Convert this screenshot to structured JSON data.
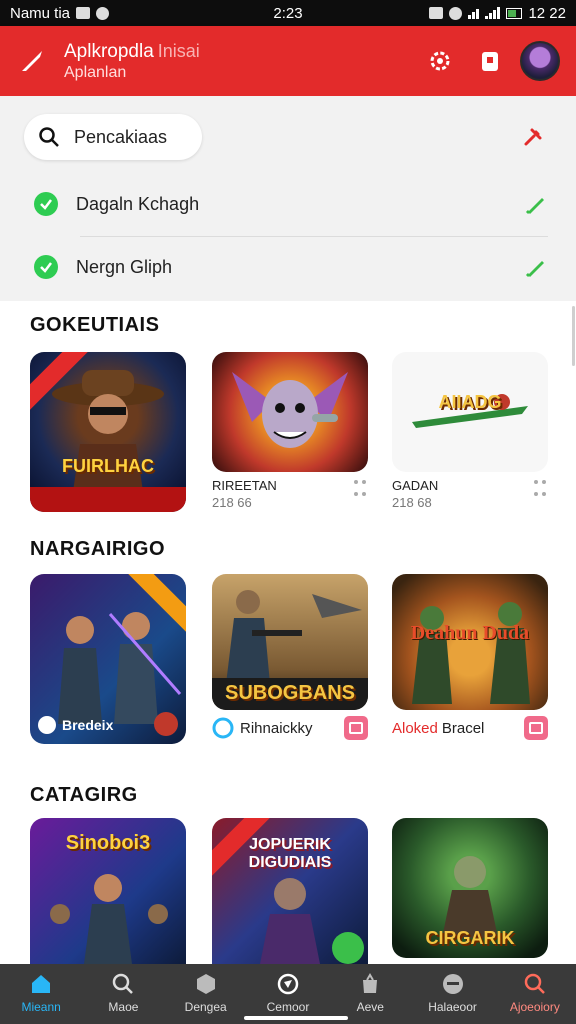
{
  "status_bar": {
    "carrier": "Namu tia",
    "time": "2:23",
    "clock_right": "12 22"
  },
  "header": {
    "title": "Aplkropdla",
    "title_accent": "Inisai",
    "subtitle": "Aplanlan",
    "color": "#e32b2b",
    "icons": [
      "brush-icon",
      "settings-icon",
      "clipboard-icon",
      "avatar"
    ]
  },
  "search": {
    "query": "Pencakiaas"
  },
  "filters": [
    {
      "label": "Dagaln Kchagh"
    },
    {
      "label": "Nergn Gliph"
    }
  ],
  "sections": [
    {
      "title": "GOKEUTIAIS",
      "cards": [
        {
          "name": "",
          "size": "",
          "art_text": "FUIRLHAC",
          "ribbon": ""
        },
        {
          "name": "RIREETAN",
          "size": "218 66"
        },
        {
          "name": "GADAN",
          "size": "218 68",
          "art_text": "AIIADG"
        }
      ]
    },
    {
      "title": "NARGAIRIGO",
      "cards": [
        {
          "name": "Bredeix"
        },
        {
          "name": "Rihnaickky",
          "art_text": "SUBOGBANS"
        },
        {
          "name": "Bracel",
          "name_prefix": "Aloked",
          "art_text": "Deahun Duda"
        }
      ]
    },
    {
      "title": "CATAGIRG",
      "cards": [
        {
          "art_text": "Sinoboi3"
        },
        {
          "art_text": "JOPUERIK DIGUDIAIS"
        },
        {
          "art_text": "CIRGARIK"
        }
      ]
    }
  ],
  "bottom_nav": [
    {
      "label": "Mieann",
      "icon": "home-icon",
      "active": true
    },
    {
      "label": "Maoe",
      "icon": "search-icon"
    },
    {
      "label": "Dengea",
      "icon": "cube-icon"
    },
    {
      "label": "Cemoor",
      "icon": "compass-icon"
    },
    {
      "label": "Aeve",
      "icon": "bag-icon"
    },
    {
      "label": "Halaeoor",
      "icon": "chat-icon"
    },
    {
      "label": "Ajoeoiory",
      "icon": "magnify-icon"
    }
  ]
}
